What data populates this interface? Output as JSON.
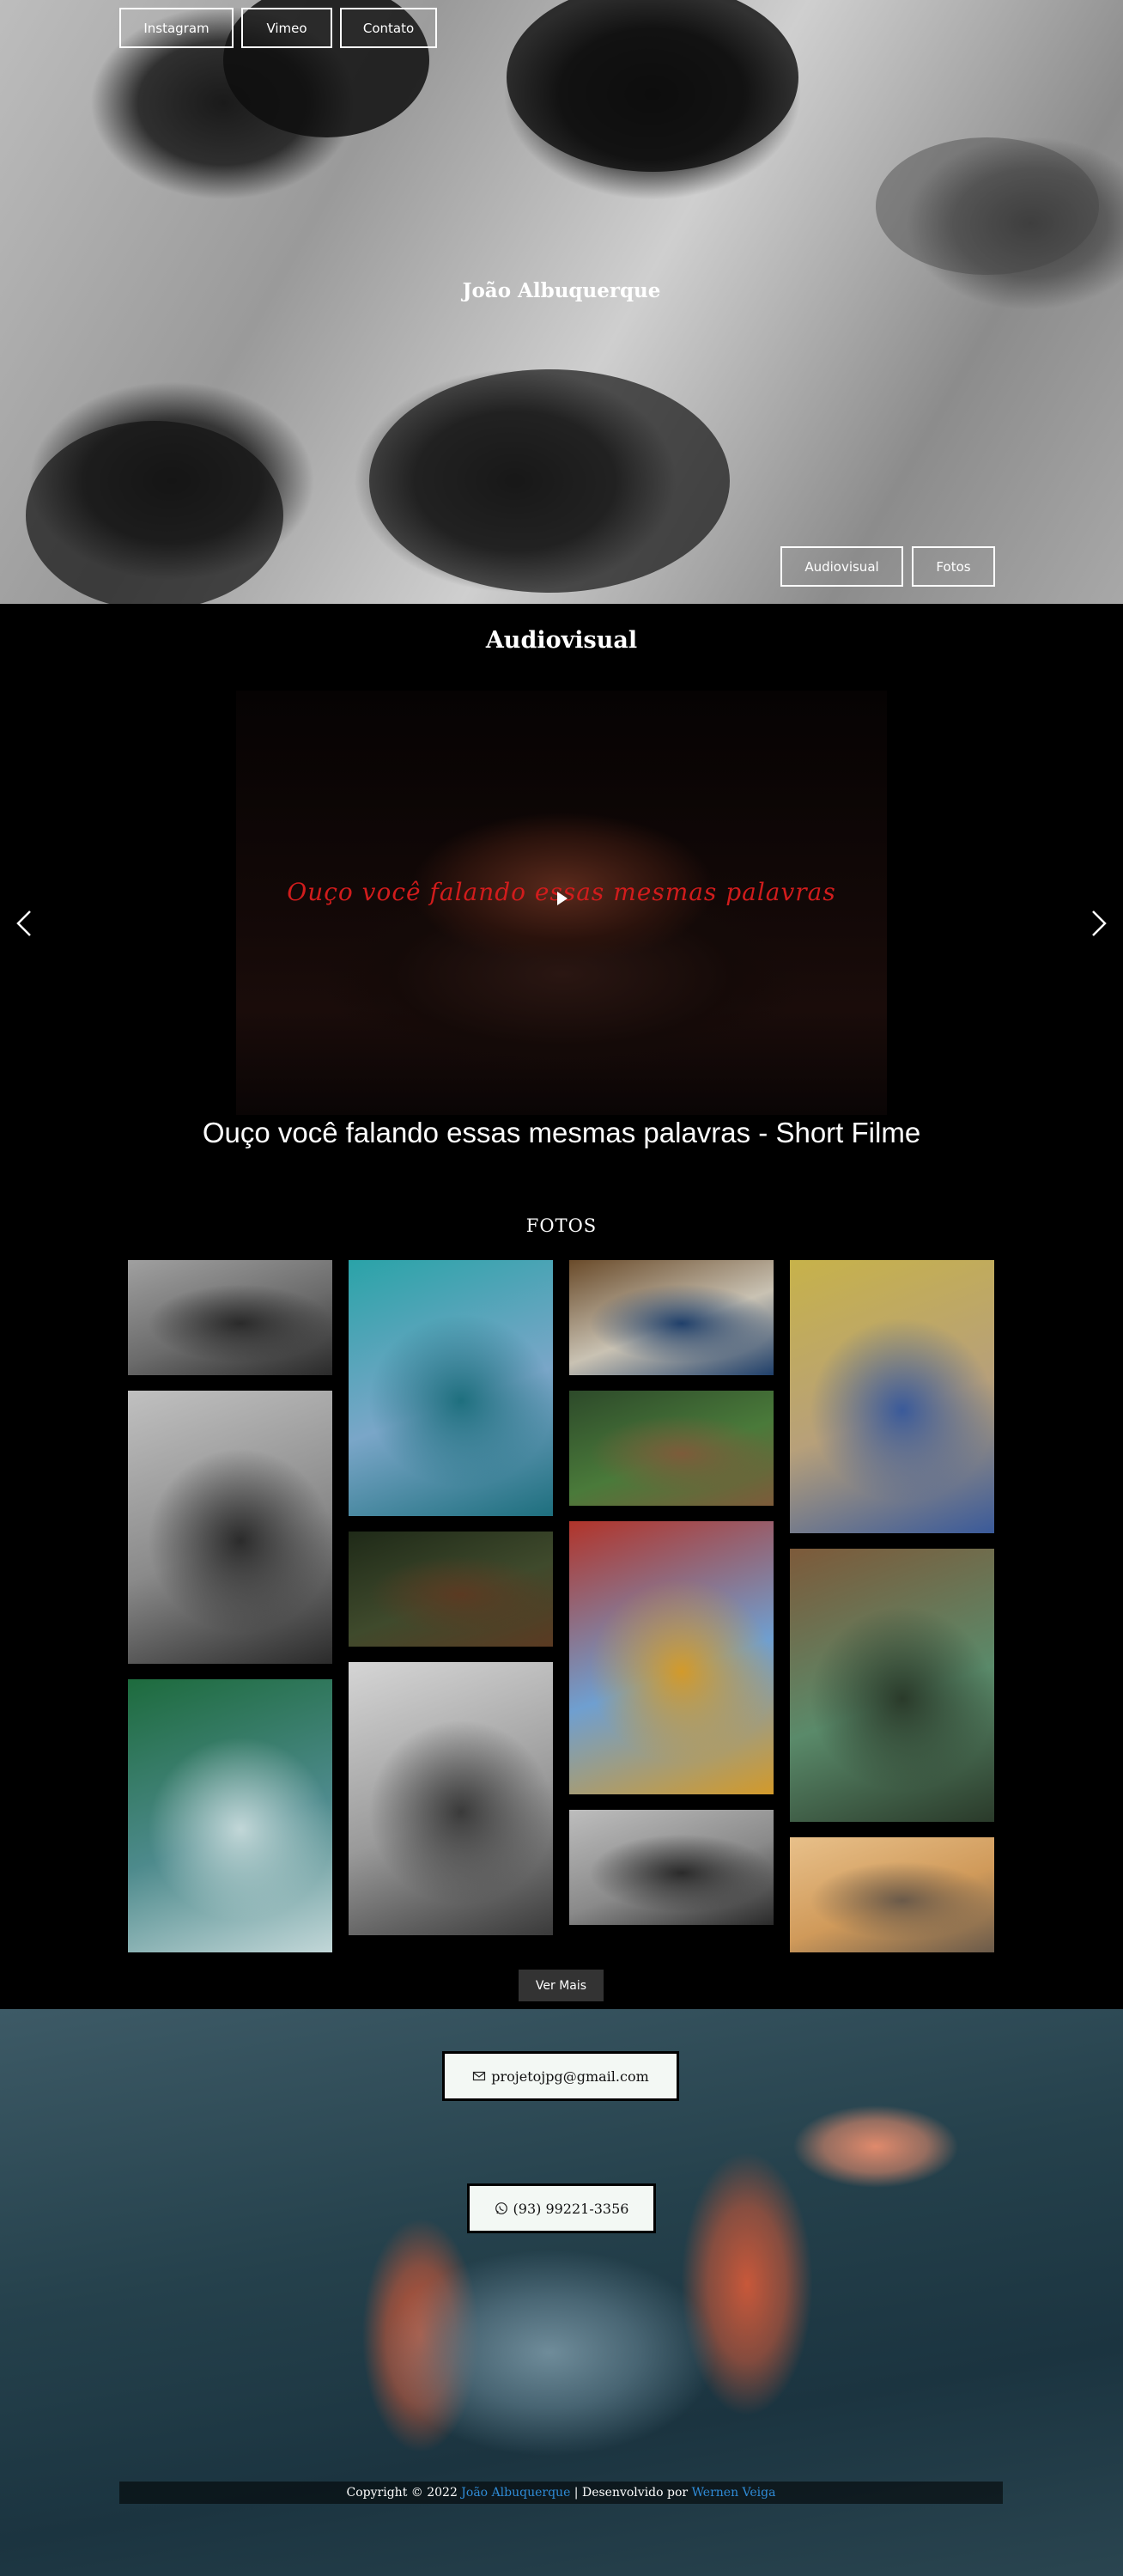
{
  "nav": {
    "instagram": "Instagram",
    "vimeo": "Vimeo",
    "contato": "Contato"
  },
  "hero": {
    "title": "João Albuquerque",
    "audiovisual_btn": "Audiovisual",
    "fotos_btn": "Fotos"
  },
  "audiovisual": {
    "title": "Audiovisual",
    "video_overlay_text": "Ouço você falando essas mesmas palavras",
    "caption": "Ouço você falando essas mesmas palavras - Short Filme"
  },
  "fotos": {
    "title": "FOTOS",
    "more_label": "Ver Mais",
    "columns": [
      [
        {
          "palette": [
            "#6b6b6b",
            "#2a2a2a",
            "#a0a0a0"
          ]
        },
        {
          "palette": [
            "#8a8a8a",
            "#2b2b2b",
            "#c0c0c0"
          ]
        },
        {
          "palette": [
            "#4d8a8c",
            "#c2d7d8",
            "#1d6b3d"
          ]
        }
      ],
      [
        {
          "palette": [
            "#7aa6c8",
            "#1e6f7e",
            "#2aa3a8"
          ]
        },
        {
          "palette": [
            "#3f4a2c",
            "#5b3a22",
            "#1f2a18"
          ]
        },
        {
          "palette": [
            "#9a9a9a",
            "#3a3a3a",
            "#d5d5d5"
          ]
        }
      ],
      [
        {
          "palette": [
            "#c9c2b3",
            "#1f3f6a",
            "#6a4b2a"
          ]
        },
        {
          "palette": [
            "#4a7a3a",
            "#7d5b3a",
            "#2d4a2a"
          ]
        },
        {
          "palette": [
            "#6f9fd0",
            "#d39a2a",
            "#b2342a"
          ]
        },
        {
          "palette": [
            "#8a8a8a",
            "#2a2a2a",
            "#bdbdbd"
          ]
        }
      ],
      [
        {
          "palette": [
            "#b7a07a",
            "#3a5a9a",
            "#c7b24a"
          ]
        },
        {
          "palette": [
            "#5a8a6a",
            "#2a3a2a",
            "#7d5a3a"
          ]
        },
        {
          "palette": [
            "#d09a5a",
            "#6a5a4a",
            "#e8c08a"
          ]
        }
      ]
    ]
  },
  "contact": {
    "email": "projetojpg@gmail.com",
    "phone": "(93) 99221-3356"
  },
  "footer": {
    "prefix": "Copyright © 2022 ",
    "owner": "João Albuquerque",
    "middle": " | Desenvolvido por ",
    "developer": "Wernen Veiga"
  }
}
